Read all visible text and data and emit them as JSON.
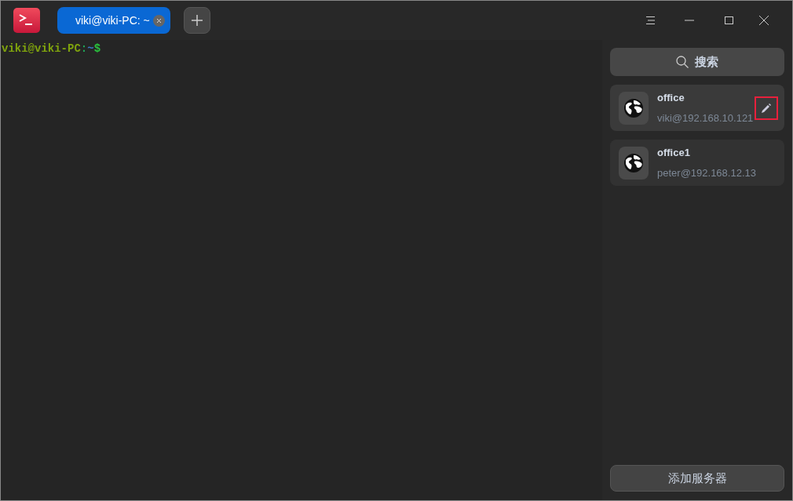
{
  "tabs": [
    {
      "label": "viki@viki-PC: ~",
      "selected": true
    }
  ],
  "prompt": [
    {
      "text": "viki@viki-PC",
      "color": "#7fa30d"
    },
    {
      "text": ":",
      "color": "#1fa85a"
    },
    {
      "text": "~",
      "color": "#3a78c4"
    },
    {
      "text": "$",
      "color": "#29c23d"
    }
  ],
  "search": {
    "label": "搜索"
  },
  "servers": [
    {
      "name": "office",
      "address": "viki@192.168.10.121",
      "hovered": true
    },
    {
      "name": "office1",
      "address": "peter@192.168.12.13",
      "hovered": false
    }
  ],
  "add_button": "添加服务器"
}
